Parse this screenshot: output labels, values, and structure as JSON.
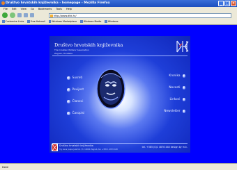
{
  "window": {
    "title": "Društvo hrvatskih književnika - homepage - Mozilla Firefox"
  },
  "menu": [
    "File",
    "Edit",
    "View",
    "Go",
    "Bookmarks",
    "Tools",
    "Help"
  ],
  "address": {
    "url": "http://www.dhk.hr/"
  },
  "bookmarks": [
    "Customize Links",
    "Free Hotmail",
    "Windows Marketplace",
    "Windows Media",
    "Windows"
  ],
  "site": {
    "title": "Društvo hrvatskih književnika",
    "subtitle1": "The Croatian Writers' Association",
    "subtitle2": "Zagreb, Hrvatska",
    "left_nav": [
      "Susreti",
      "Povijest",
      "Članovi",
      "Časopisi"
    ],
    "right_nav": [
      "Kronika",
      "Novosti",
      "Linkovi",
      "Newsletter"
    ],
    "footer_name": "Društvo hrvatskih književnika",
    "footer_address": "Trg bana Josipa Jelačića 7/I, 10000 Zagreb, tel. +385 1 4876 448",
    "footer_right": "tel. +385 (0)1 4876 448   design by m.k."
  },
  "status": {
    "text": "Done"
  },
  "colors": {
    "page_bg": "#0000ff",
    "titlebar": "#1b4fbf",
    "chrome": "#ece9d8"
  }
}
